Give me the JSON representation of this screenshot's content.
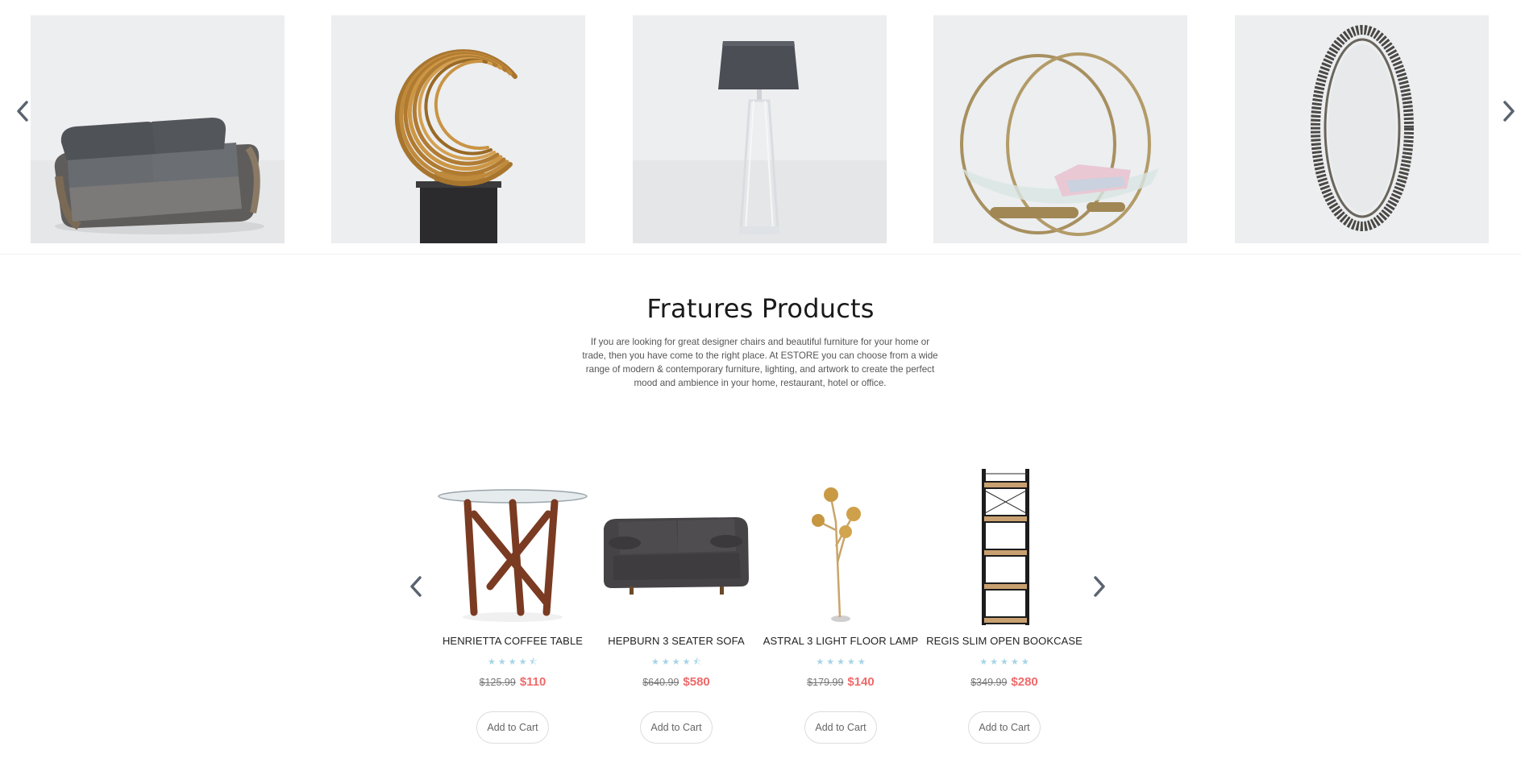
{
  "top_carousel": {
    "items": [
      {
        "icon": "sofa-image"
      },
      {
        "icon": "crescent-sculpture-image"
      },
      {
        "icon": "floor-lamp-image"
      },
      {
        "icon": "magazine-rack-image"
      },
      {
        "icon": "round-mirror-image"
      }
    ],
    "prev_icon": "chevron-left-icon",
    "next_icon": "chevron-right-icon"
  },
  "featured": {
    "title": "Fratures Products",
    "description": "If you are looking for great designer chairs and beautiful furniture for your home or trade, then you have come to the right place. At ESTORE you can choose from a wide range of modern & contemporary furniture, lighting, and artwork to create the perfect mood and ambience in your home, restaurant, hotel or office."
  },
  "products": [
    {
      "name": "HENRIETTA COFFEE TABLE",
      "old_price": "$125.99",
      "price": "$110",
      "rating": 4.5,
      "button": "Add to Cart",
      "icon": "coffee-table-image"
    },
    {
      "name": "HEPBURN 3 SEATER SOFA",
      "old_price": "$640.99",
      "price": "$580",
      "rating": 4.5,
      "button": "Add to Cart",
      "icon": "sofa-image"
    },
    {
      "name": "ASTRAL 3 LIGHT FLOOR LAMP",
      "old_price": "$179.99",
      "price": "$140",
      "rating": 5,
      "button": "Add to Cart",
      "icon": "floor-lamp-image"
    },
    {
      "name": "REGIS SLIM OPEN BOOKCASE",
      "old_price": "$349.99",
      "price": "$280",
      "rating": 5,
      "button": "Add to Cart",
      "icon": "bookcase-image"
    }
  ],
  "colors": {
    "tile_background": "#eeeff1",
    "star": "#a6d4e6",
    "sale_price": "#ef6a6a",
    "arrow": "#5a6470"
  }
}
